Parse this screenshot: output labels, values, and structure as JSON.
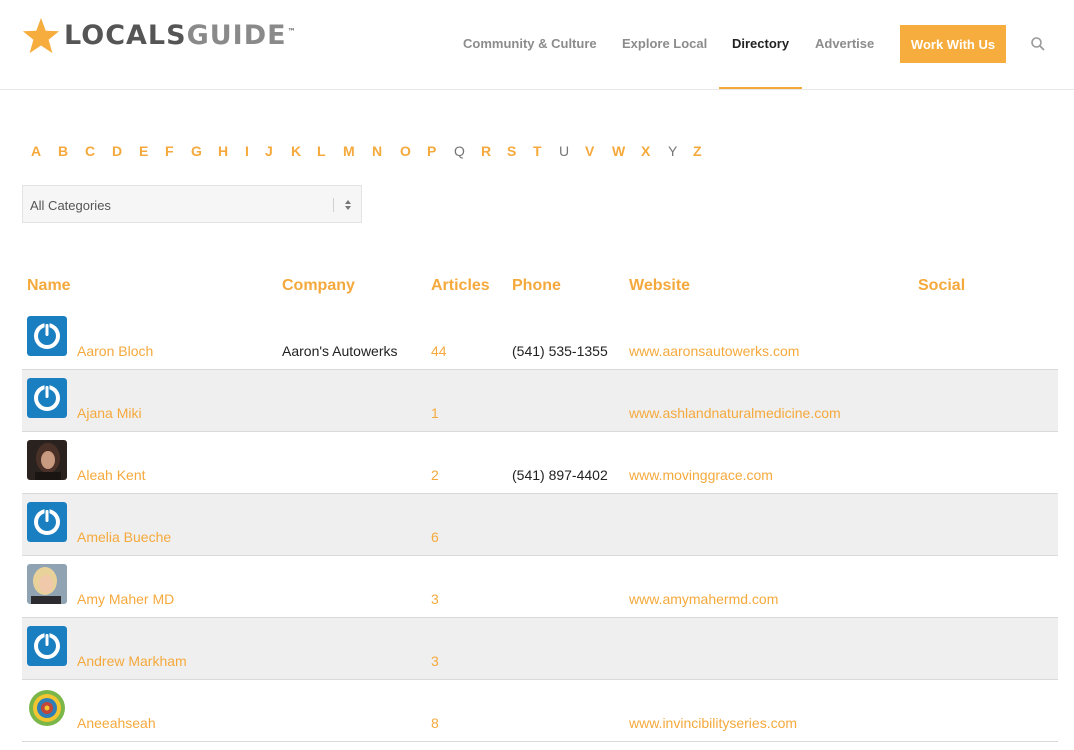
{
  "header": {
    "logo": {
      "part1": "LOCALS",
      "part2": "GUIDE",
      "tm": "™",
      "star_color": "#f6ad3e"
    },
    "nav": [
      {
        "label": "Community & Culture",
        "active": false
      },
      {
        "label": "Explore Local",
        "active": false
      },
      {
        "label": "Directory",
        "active": true
      },
      {
        "label": "Advertise",
        "active": false
      }
    ],
    "cta_label": "Work With Us",
    "search_icon": "search-icon"
  },
  "letters": [
    {
      "label": "A",
      "active": true
    },
    {
      "label": "B",
      "active": true
    },
    {
      "label": "C",
      "active": true
    },
    {
      "label": "D",
      "active": true
    },
    {
      "label": "E",
      "active": true
    },
    {
      "label": "F",
      "active": true
    },
    {
      "label": "G",
      "active": true
    },
    {
      "label": "H",
      "active": true
    },
    {
      "label": "I",
      "active": true
    },
    {
      "label": "J",
      "active": true
    },
    {
      "label": "K",
      "active": true
    },
    {
      "label": "L",
      "active": true
    },
    {
      "label": "M",
      "active": true
    },
    {
      "label": "N",
      "active": true
    },
    {
      "label": "O",
      "active": true
    },
    {
      "label": "P",
      "active": true
    },
    {
      "label": "Q",
      "active": false
    },
    {
      "label": "R",
      "active": true
    },
    {
      "label": "S",
      "active": true
    },
    {
      "label": "T",
      "active": true
    },
    {
      "label": "U",
      "active": false
    },
    {
      "label": "V",
      "active": true
    },
    {
      "label": "W",
      "active": true
    },
    {
      "label": "X",
      "active": true
    },
    {
      "label": "Y",
      "active": false
    },
    {
      "label": "Z",
      "active": true
    }
  ],
  "category_select": {
    "selected": "All Categories"
  },
  "table": {
    "columns": [
      "Name",
      "Company",
      "Articles",
      "Phone",
      "Website",
      "Social"
    ],
    "rows": [
      {
        "avatar": "power-avatar",
        "name": "Aaron Bloch",
        "company": "Aaron's Autowerks",
        "articles": "44",
        "phone": "(541) 535-1355",
        "website": "www.aaronsautowerks.com"
      },
      {
        "avatar": "power-avatar",
        "name": "Ajana Miki",
        "company": "",
        "articles": "1",
        "phone": "",
        "website": "www.ashlandnaturalmedicine.com"
      },
      {
        "avatar": "photo-dark-avatar",
        "name": "Aleah Kent",
        "company": "",
        "articles": "2",
        "phone": "(541) 897-4402",
        "website": "www.movinggrace.com"
      },
      {
        "avatar": "power-avatar",
        "name": "Amelia Bueche",
        "company": "",
        "articles": "6",
        "phone": "",
        "website": ""
      },
      {
        "avatar": "photo-light-avatar",
        "name": "Amy Maher MD",
        "company": "",
        "articles": "3",
        "phone": "",
        "website": "www.amymahermd.com"
      },
      {
        "avatar": "power-avatar",
        "name": "Andrew Markham",
        "company": "",
        "articles": "3",
        "phone": "",
        "website": ""
      },
      {
        "avatar": "mandala-avatar",
        "name": "Aneeahseah",
        "company": "",
        "articles": "8",
        "phone": "",
        "website": "www.invincibilityseries.com"
      }
    ]
  },
  "colors": {
    "accent": "#f5a93c",
    "row_alt": "#efefef",
    "avatar_blue": "#1a7fc1"
  }
}
